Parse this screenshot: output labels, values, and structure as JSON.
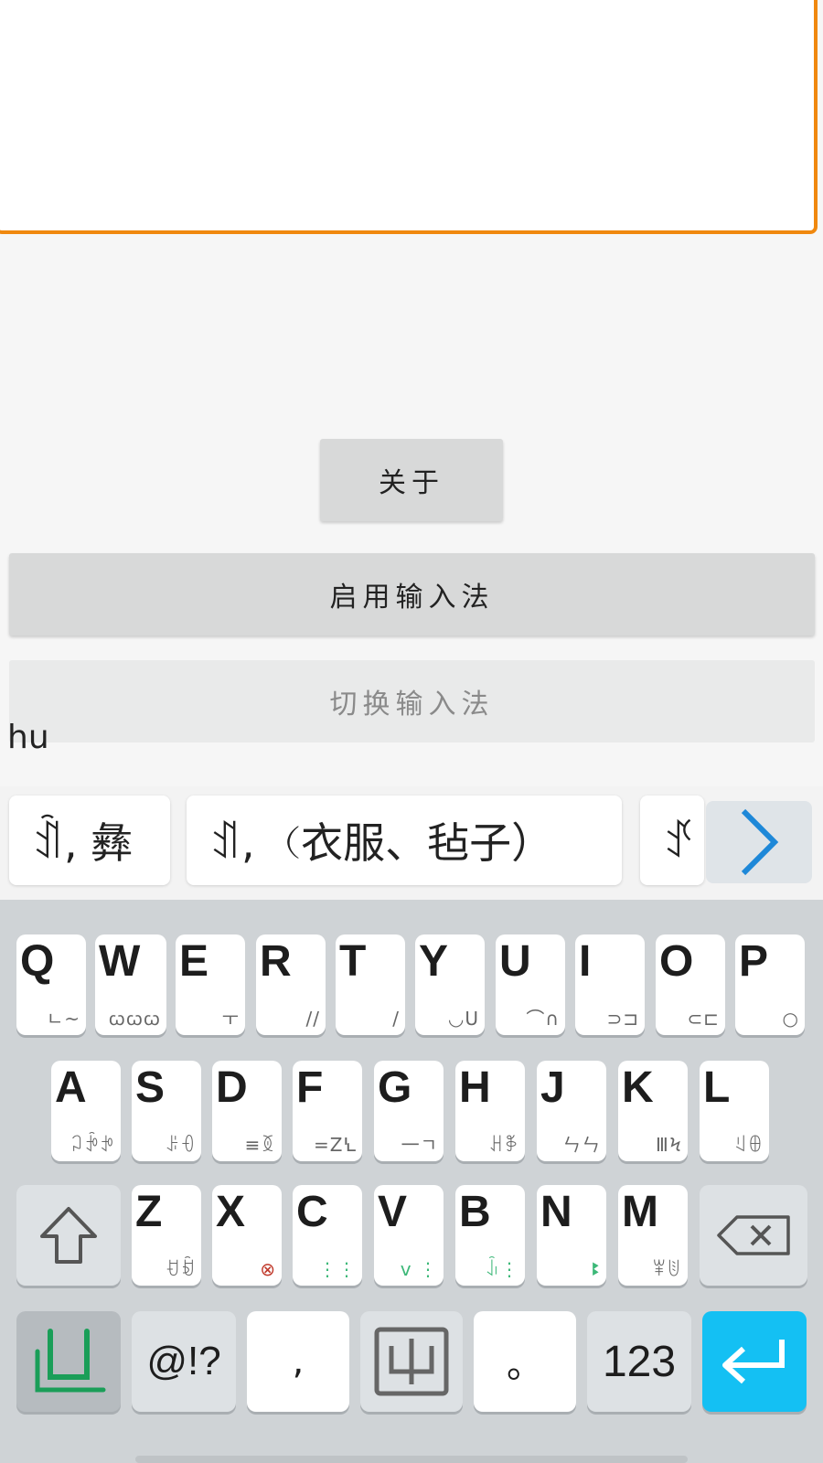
{
  "app": {
    "about_label": "关于",
    "enable_label": "启用输入法",
    "switch_label": "切换输入法",
    "composing_text": "hu"
  },
  "candidates": [
    {
      "text": "ꀉ, 彝"
    },
    {
      "text": "ꀊ, （衣服、毡子）"
    },
    {
      "text": "ꀋ"
    }
  ],
  "keyboard": {
    "row1": [
      {
        "letter": "Q",
        "sub": "ㄴ~"
      },
      {
        "letter": "W",
        "sub": "ꞷꞷꞷ"
      },
      {
        "letter": "E",
        "sub": "ㅜ"
      },
      {
        "letter": "R",
        "sub": "//"
      },
      {
        "letter": "T",
        "sub": "/"
      },
      {
        "letter": "Y",
        "sub": "◡U"
      },
      {
        "letter": "U",
        "sub": "⌒∩"
      },
      {
        "letter": "I",
        "sub": "⊃⊐"
      },
      {
        "letter": "O",
        "sub": "⊂⊏"
      },
      {
        "letter": "P",
        "sub": "○"
      }
    ],
    "row2": [
      {
        "letter": "A",
        "sub": "ꃀꃁꃂ"
      },
      {
        "letter": "S",
        "sub": "ꌠꌡ"
      },
      {
        "letter": "D",
        "sub": "≡ꅉ"
      },
      {
        "letter": "F",
        "sub": "=ZꝆ"
      },
      {
        "letter": "G",
        "sub": "一ㄱ"
      },
      {
        "letter": "H",
        "sub": "ꃅꃆ"
      },
      {
        "letter": "J",
        "sub": "ㄣㄣ"
      },
      {
        "letter": "K",
        "sub": "ⅢϞ"
      },
      {
        "letter": "L",
        "sub": "ꆹꆺ"
      }
    ],
    "row3": [
      {
        "letter": "Z",
        "sub": "ꀀꀁ"
      },
      {
        "letter": "X",
        "sub": "⊗"
      },
      {
        "letter": "C",
        "sub": "⋮⋮"
      },
      {
        "letter": "V",
        "sub": "v ⋮"
      },
      {
        "letter": "B",
        "sub": "ꀭ⋮"
      },
      {
        "letter": "N",
        "sub": "ꔪ"
      },
      {
        "letter": "M",
        "sub": "ꂸꂹ"
      }
    ],
    "row4": {
      "symbols_label": "@!?",
      "comma_label": ",",
      "period_label": "。",
      "num_label": "123"
    },
    "colors": {
      "enter_bg": "#14c0f3",
      "accent_orange": "#f0880f",
      "chevron_blue": "#1e88d8"
    }
  }
}
